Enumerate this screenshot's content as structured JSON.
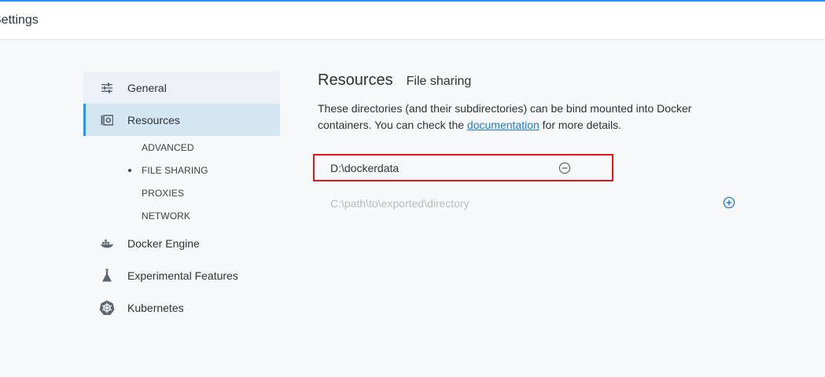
{
  "header": {
    "title": "Settings"
  },
  "sidebar": {
    "items": [
      {
        "label": "General",
        "icon": "sliders-icon"
      },
      {
        "label": "Resources",
        "icon": "resources-icon"
      },
      {
        "label": "Docker Engine",
        "icon": "whale-icon"
      },
      {
        "label": "Experimental Features",
        "icon": "flask-icon"
      },
      {
        "label": "Kubernetes",
        "icon": "helm-wheel-icon"
      }
    ],
    "sub_items": [
      {
        "label": "ADVANCED"
      },
      {
        "label": "FILE SHARING"
      },
      {
        "label": "PROXIES"
      },
      {
        "label": "NETWORK"
      }
    ]
  },
  "main": {
    "title": "Resources",
    "subtitle": "File sharing",
    "description_before": "These directories (and their subdirectories) can be bind mounted into Docker containers. You can check the ",
    "description_link": "documentation",
    "description_after": " for more details.",
    "shared_directory": "D:\\dockerdata",
    "new_directory_placeholder": "C:\\path\\to\\exported\\directory"
  },
  "colors": {
    "accent": "#2496ed",
    "highlight_border": "#e0161a",
    "link": "#1d7acf"
  }
}
